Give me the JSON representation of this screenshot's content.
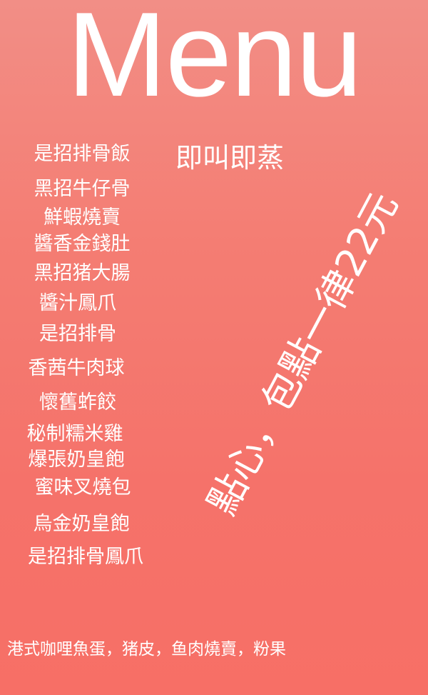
{
  "title": "Menu",
  "tagline": "即叫即蒸",
  "price_note": "點心，包點一律22元",
  "dishes": [
    "是招排骨飯",
    "黑招牛仔骨",
    "鮮蝦燒賣",
    "醬香金錢肚",
    "黑招猪大腸",
    "醬汁鳳爪",
    "是招排骨",
    "香茜牛肉球",
    "懷舊蚱餃",
    "秘制糯米雞",
    "爆張奶皇飽",
    "蜜味叉燒包",
    "烏金奶皇飽",
    "是招排骨鳳爪"
  ],
  "footer_note": "港式咖哩魚蛋，猪皮，鱼肉燒賣，粉果",
  "colors": {
    "background_top": "#f28e86",
    "background_bottom": "#f76f66",
    "text": "#ffffff"
  }
}
